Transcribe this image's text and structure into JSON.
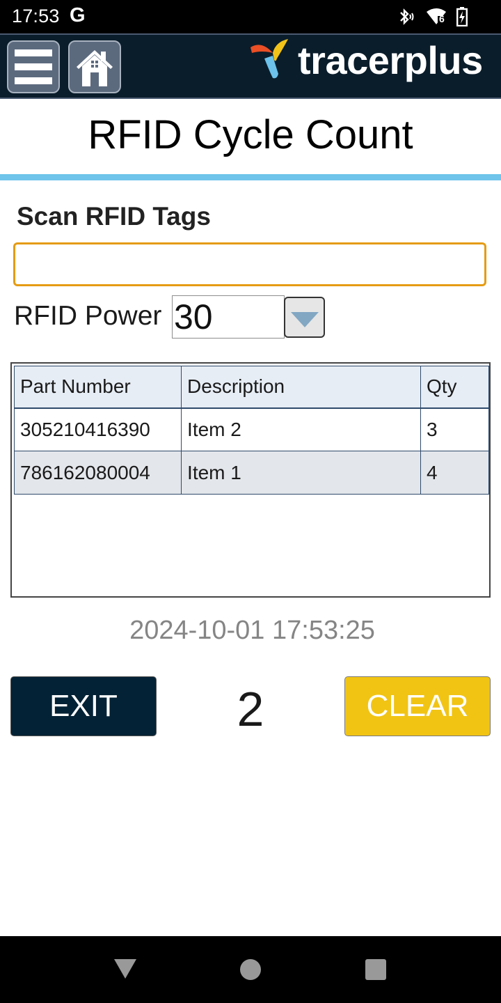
{
  "status_bar": {
    "time": "17:53",
    "google_indicator": "G",
    "icons": [
      "bluetooth-icon",
      "wifi-icon",
      "battery-charging-icon"
    ],
    "wifi_badge": "6"
  },
  "header": {
    "menu_icon": "hamburger-menu-icon",
    "home_icon": "home-icon",
    "logo_text": "tracerplus"
  },
  "page": {
    "title": "RFID Cycle Count"
  },
  "scan": {
    "label": "Scan RFID Tags",
    "value": "",
    "placeholder": ""
  },
  "power": {
    "label": "RFID Power",
    "value": "30"
  },
  "table": {
    "columns": [
      "Part Number",
      "Description",
      "Qty"
    ],
    "rows": [
      {
        "part_number": "305210416390",
        "description": "Item 2",
        "qty": "3"
      },
      {
        "part_number": "786162080004",
        "description": "Item 1",
        "qty": "4"
      }
    ]
  },
  "footer": {
    "timestamp": "2024-10-01 17:53:25",
    "exit_label": "EXIT",
    "count": "2",
    "clear_label": "CLEAR"
  },
  "colors": {
    "header_bg": "#0a1d2b",
    "accent_rule": "#6ec4ea",
    "input_border": "#e59c13",
    "exit_bg": "#042235",
    "clear_bg": "#f1c414"
  },
  "nav_bar": {
    "icons": [
      "back-icon",
      "home-circle-icon",
      "recents-icon"
    ]
  }
}
